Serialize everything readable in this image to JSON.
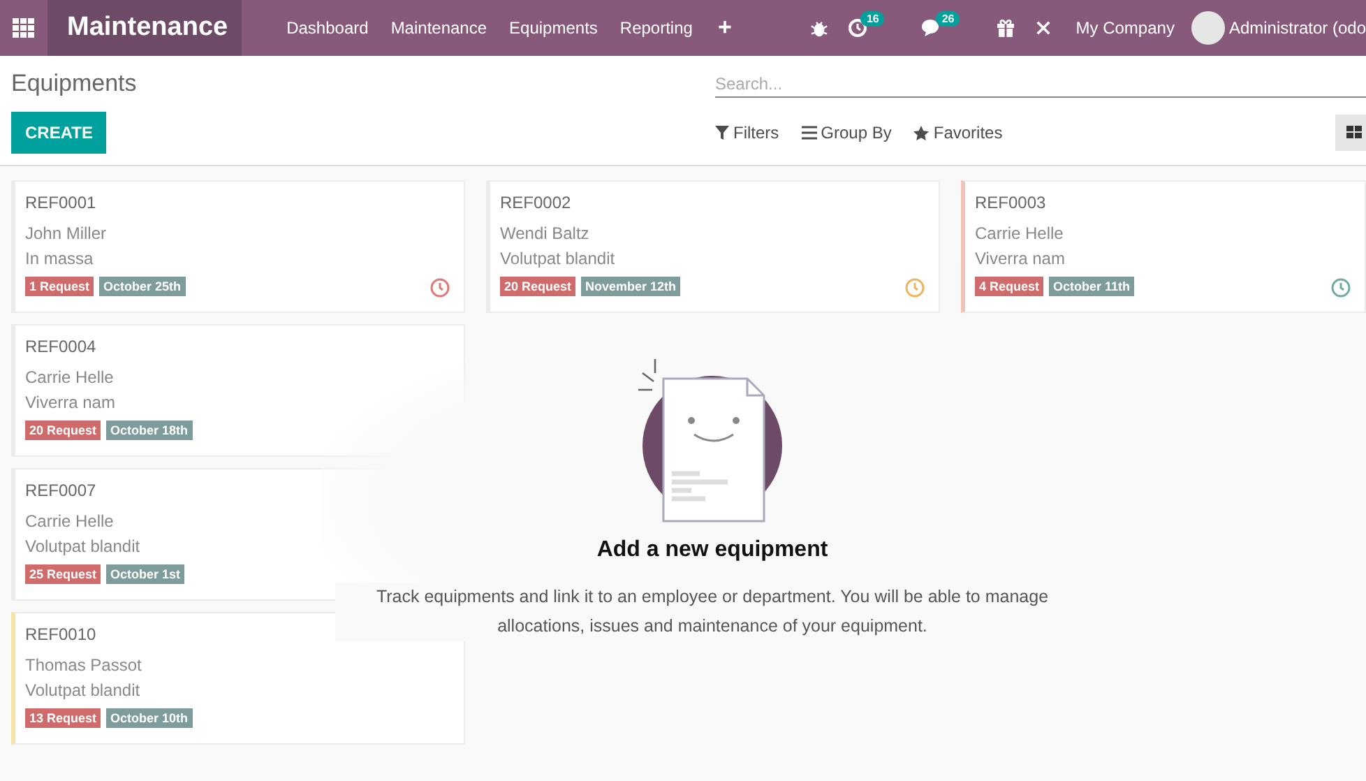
{
  "navbar": {
    "app_name": "Maintenance",
    "menu": [
      "Dashboard",
      "Maintenance",
      "Equipments",
      "Reporting"
    ],
    "plus": "+",
    "activity_count": "16",
    "message_count": "26",
    "company": "My Company",
    "user": "Administrator (odo"
  },
  "control_panel": {
    "breadcrumb": "Equipments",
    "search": {
      "placeholder": "Search..."
    },
    "create": "CREATE",
    "filters": [
      "Filters",
      "Group By",
      "Favorites"
    ]
  },
  "cards": [
    {
      "ref": "REF0001",
      "employee": "John Miller",
      "model": "In massa",
      "requests": "1 Request",
      "date": "October 25th",
      "activity": {
        "color": "#e07a76"
      }
    },
    {
      "ref": "REF0002",
      "employee": "Wendi Baltz",
      "model": "Volutpat blandit",
      "requests": "20 Request",
      "date": "November 12th",
      "activity": {
        "color": "#f0b35e"
      }
    },
    {
      "ref": "REF0003",
      "employee": "Carrie Helle",
      "model": "Viverra nam",
      "requests": "4 Request",
      "date": "October 11th",
      "color": "#f1c4b8",
      "activity": {
        "color": "#6fae9a"
      }
    },
    {
      "ref": "REF0004",
      "employee": "Carrie Helle",
      "model": "Viverra nam",
      "requests": "20 Request",
      "date": "October 18th"
    },
    {
      "ref": "REF0007",
      "employee": "Carrie Helle",
      "model": "Volutpat blandit",
      "requests": "25 Request",
      "date": "October 1st"
    },
    {
      "ref": "REF0010",
      "employee": "Thomas Passot",
      "model": "Volutpat blandit",
      "requests": "13 Request",
      "date": "October 10th",
      "color": "#f7e3a8"
    }
  ],
  "helper": {
    "title": "Add a new equipment",
    "text": "Track equipments and link it to an employee or department. You will be able to manage allocations, issues and maintenance of your equipment."
  }
}
